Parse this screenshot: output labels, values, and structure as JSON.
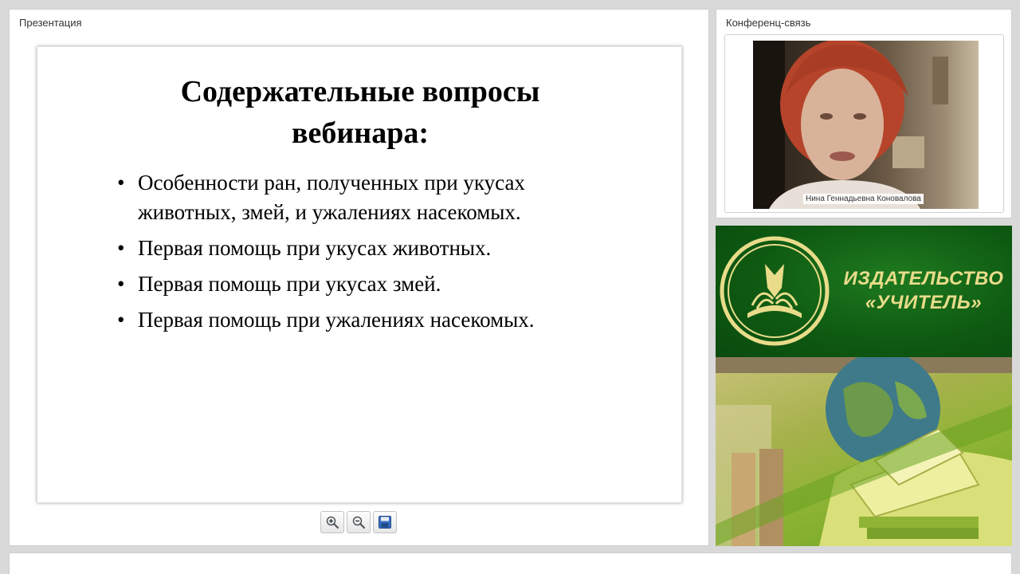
{
  "presentation_panel": {
    "title": "Презентация",
    "slide": {
      "title": "Содержательные вопросы вебинара:",
      "bullets": [
        "Особенности ран, полученных при укусах животных, змей, и ужалениях насекомых.",
        "Первая помощь при укусах животных.",
        "Первая помощь при укусах змей.",
        "Первая помощь при ужалениях насекомых."
      ]
    },
    "toolbar": {
      "zoom_in_icon": "zoom-in-icon",
      "zoom_out_icon": "zoom-out-icon",
      "save_icon": "save-icon"
    }
  },
  "conference_panel": {
    "title": "Конференц-связь",
    "participant_name": "Нина Геннадьевна Коновалова"
  },
  "publisher_banner": {
    "line1": "ИЗДАТЕЛЬСТВО",
    "line2": "«УЧИТЕЛЬ»",
    "brand_green": "#0e5a12",
    "brand_gold": "#e8dc8a"
  }
}
